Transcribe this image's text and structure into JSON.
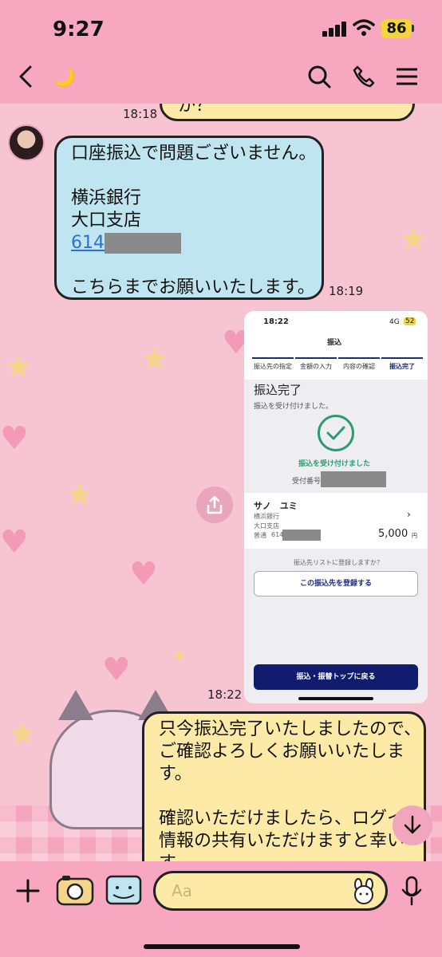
{
  "status": {
    "time": "9:27",
    "battery": "86"
  },
  "header": {
    "contact_name": "🌙"
  },
  "messages": {
    "top_partial": {
      "text": "か？",
      "time": "18:18"
    },
    "received": {
      "lines": [
        "口座振込で問題ございません。",
        "",
        "横浜銀行",
        "大口支店"
      ],
      "account_prefix": "614",
      "closing": "こちらまでお願いいたします。",
      "time": "18:19"
    },
    "image_time": "18:22",
    "sent": {
      "lines": [
        "只今振込完了いたしましたので、",
        "ご確認よろしくお願いいたしま",
        "す。",
        "",
        "確認いただけましたら、ログイ",
        "情報の共有いただけますと幸い",
        "す"
      ]
    }
  },
  "screenshot": {
    "time": "18:22",
    "network": "4G",
    "battery": "52",
    "title": "振込",
    "tabs": [
      "振込先の指定",
      "金額の入力",
      "内容の確認",
      "振込完了"
    ],
    "heading": "振込完了",
    "subheading": "振込を受け付けました。",
    "accepted": "振込を受け付けました",
    "receipt_label": "受付番号",
    "payee": "サノ　ユミ",
    "bank": "横浜銀行",
    "branch": "大口支店",
    "account_type": "普通",
    "account_prefix": "614",
    "amount": "5,000",
    "currency": "円",
    "register_prompt": "振込先リストに登録しますか？",
    "register_button": "この振込先を登録する",
    "top_button": "振込・振替トップに戻る"
  },
  "input": {
    "placeholder": "Aa"
  },
  "colors": {
    "header": "#f7a7c0",
    "chat_bg": "#f7c4d2",
    "received": "#bfe6f0",
    "sent": "#fdeaa7",
    "bank_navy": "#121c6e",
    "success": "#2e9b6e"
  },
  "icons": [
    "back-icon",
    "search-icon",
    "phone-icon",
    "menu-icon",
    "share-icon",
    "plus-icon",
    "camera-icon",
    "image-icon",
    "sticker-icon",
    "mic-icon",
    "arrow-down-icon"
  ]
}
